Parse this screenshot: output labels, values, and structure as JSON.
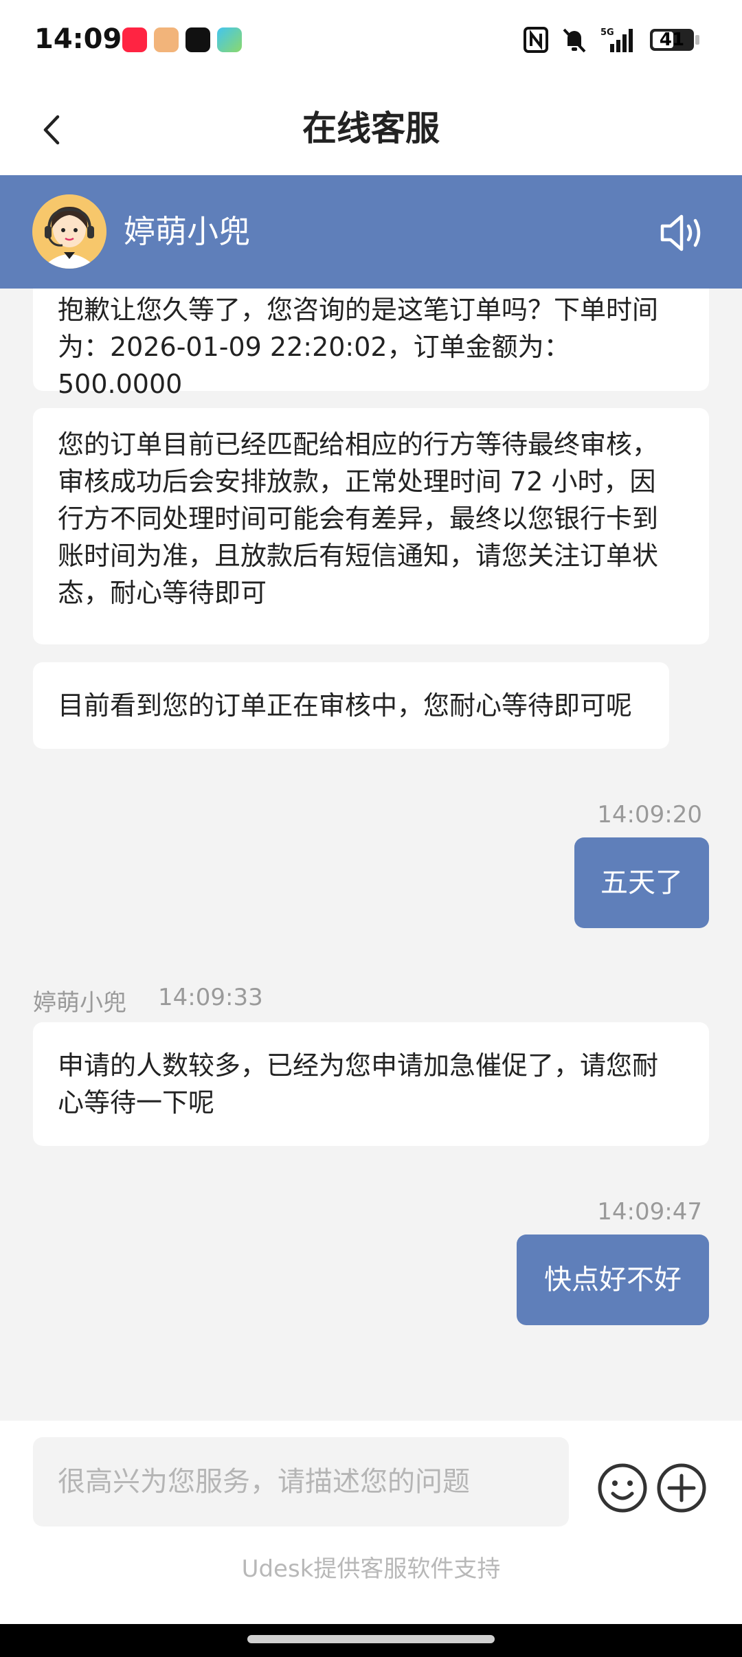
{
  "status": {
    "time": "14:09",
    "battery": "41",
    "network": "5G"
  },
  "header": {
    "title": "在线客服",
    "back_icon": "chevron-left-icon"
  },
  "agent": {
    "name": "婷萌小兜",
    "speaker_icon": "speaker-icon"
  },
  "messages": [
    {
      "side": "left",
      "text_line1": "抱歉让您久等了，您咨询的是这笔订单吗？下单时间",
      "text_line2": "为：2026-01-09 22:20:02，订单金额为：500.0000"
    },
    {
      "side": "left",
      "text_line1": "您的订单目前已经匹配给相应的行方等待最终审核，",
      "text_line2": "审核成功后会安排放款，正常处理时间 72 小时，因",
      "text_line3": "行方不同处理时间可能会有差异，最终以您银行卡到",
      "text_line4": "账时间为准，且放款后有短信通知，请您关注订单状",
      "text_line5": "态，耐心等待即可"
    },
    {
      "side": "left",
      "text": "目前看到您的订单正在审核中，您耐心等待即可呢"
    },
    {
      "side": "right",
      "time": "14:09:20",
      "text": "五天了"
    },
    {
      "side": "left",
      "sender": "婷萌小兜",
      "time": "14:09:33",
      "text_line1": "申请的人数较多，已经为您申请加急催促了，请您耐",
      "text_line2": "心等待一下呢"
    },
    {
      "side": "right",
      "time": "14:09:47",
      "text": "快点好不好"
    }
  ],
  "input": {
    "placeholder": "很高兴为您服务，请描述您的问题",
    "emoji_icon": "emoji-icon",
    "plus_icon": "plus-icon"
  },
  "footer": {
    "powered_by": "Udesk提供客服软件支持"
  },
  "colors": {
    "accent": "#5f7fba",
    "background": "#f3f3f3"
  }
}
